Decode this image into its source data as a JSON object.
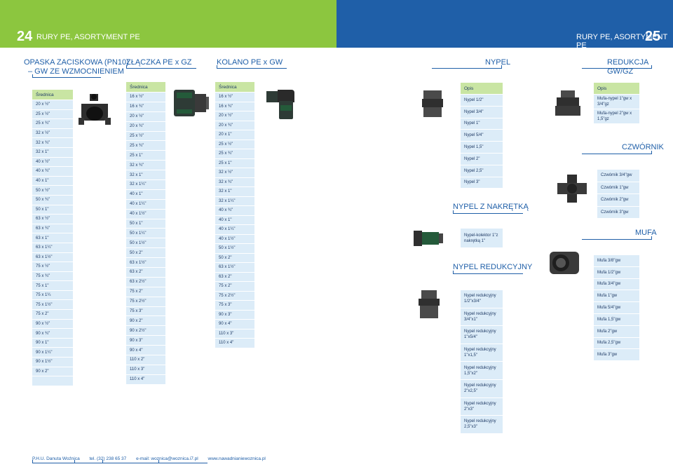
{
  "header": {
    "left_page_num": "24",
    "left_title": "RURY PE, ASORTYMENT PE",
    "right_title": "RURY PE, ASORTYMENT PE",
    "right_page_num": "25",
    "left_color": "#8cc63f",
    "right_color": "#1f5fa8"
  },
  "sections": {
    "opaska": {
      "title_line1": "OPASKA ZACISKOWA (PN10)",
      "title_line2": "– GW ZE WZMOCNIENIEM"
    },
    "zlaczka": {
      "title": "ZŁĄCZKA PE x GZ"
    },
    "kolano": {
      "title": "KOLANO PE x GW"
    },
    "nypel": {
      "title": "NYPEL"
    },
    "redukcja": {
      "title": "REDUKCJA GW/GZ"
    },
    "czwornik": {
      "title": "CZWÓRNIK"
    },
    "nypel_nakretka": {
      "title": "NYPEL Z NAKRĘTKĄ"
    },
    "mufa": {
      "title": "MUFA"
    },
    "nypel_redukcyjny": {
      "title": "NYPEL REDUKCYJNY"
    }
  },
  "opaska_table": {
    "header": "Średnica",
    "rows": [
      "20 x ½\"",
      "25 x ½\"",
      "25 x ¾\"",
      "32 x ½\"",
      "32 x ¾\"",
      "32 x 1\"",
      "40 x ½\"",
      "40 x ¾\"",
      "40 x 1\"",
      "50 x ½\"",
      "50 x ¾\"",
      "50 x 1\"",
      "63 x ½\"",
      "63 x ¾\"",
      "63 x 1\"",
      "63 x 1¼\"",
      "63 x 1½\"",
      "75 x ½\"",
      "75 x ¾\"",
      "75 x 1\"",
      "75 x 1¼",
      "75 x 1½\"",
      "75 x 2\"",
      "90 x ½\"",
      "90 x ¾\"",
      "90 x 1\"",
      "90 x 1¼\"",
      "90 x 1½\"",
      "90 x 2\"",
      ""
    ]
  },
  "zlaczka_table": {
    "header": "Średnica",
    "rows": [
      "16 x ½\"",
      "16 x ¾\"",
      "20 x ½\"",
      "20 x ¾\"",
      "25 x ½\"",
      "25 x ¾\"",
      "25 x 1\"",
      "32 x ¾\"",
      "32 x 1\"",
      "32 x 1¼\"",
      "40 x 1\"",
      "40 x 1¼\"",
      "40 x 1½\"",
      "50 x 1\"",
      "50 x 1¼\"",
      "50 x 1½\"",
      "50 x 2\"",
      "63 x 1½\"",
      "63 x 2\"",
      "63 x 2½\"",
      "75 x 2\"",
      "75 x 2½\"",
      "75 x 3\"",
      "90 x 2\"",
      "90 x 2½\"",
      "90 x 3\"",
      "90 x 4\"",
      "110 x 2\"",
      "110 x 3\"",
      "110 x 4\""
    ]
  },
  "kolano_table": {
    "header": "Średnica",
    "rows": [
      "16 x ½\"",
      "16 x ¾\"",
      "20 x ½\"",
      "20 x ¾\"",
      "20 x 1\"",
      "25 x ½\"",
      "25 x ¾\"",
      "25 x 1\"",
      "32 x ½\"",
      "32 x ¾\"",
      "32 x 1\"",
      "32 x 1¼\"",
      "40 x ¾\"",
      "40 x 1\"",
      "40 x 1¼\"",
      "40 x 1½\"",
      "50 x 1½\"",
      "50 x 2\"",
      "63 x 1½\"",
      "63 x 2\"",
      "75 x 2\"",
      "75 x 2½\"",
      "75 x 3\"",
      "90 x 3\"",
      "90 x 4\"",
      "110 x 3\"",
      "110 x 4\""
    ]
  },
  "nypel_table": {
    "header": "Opis",
    "rows": [
      "Nypel 1/2\"",
      "Nypel 3/4\"",
      "Nypel 1\"",
      "Nypel 5/4\"",
      "Nypel 1,5\"",
      "Nypel 2\"",
      "Nypel 2,5\"",
      "Nypel 3\""
    ]
  },
  "redukcja_table": {
    "header": "Opis",
    "rows": [
      "Mufa-nypel 1\"gw x 3/4\"gz",
      "Mufa-nypel 2\"gw x 1,5\"gz"
    ]
  },
  "czwornik_table": {
    "rows": [
      "Czwórnik 3/4\"gw",
      "Czwórnik 1\"gw",
      "Czwórnik 2\"gw",
      "Czwórnik 3\"gw"
    ]
  },
  "nakretka_table": {
    "rows": [
      "Nypel-kolektor 1\"z nakrętką 1\""
    ]
  },
  "mufa_table": {
    "rows": [
      "Mufa 3/8\"gw",
      "Mufa 1/2\"gw",
      "Mufa 3/4\"gw",
      "Mufa 1\"gw",
      "Mufa 5/4\"gw",
      "Mufa 1,5\"gw",
      "Mufa 2\"gw",
      "Mufa 2,5\"gw",
      "Mufa 3\"gw"
    ]
  },
  "redukcyjny_table": {
    "rows": [
      "Nypel redukcyjny 1/2\"x3/4\"",
      "Nypel redukcyjny 3/4\"x1\"",
      "Nypel redukcyjny 1\"x5/4\"",
      "Nypel redukcyjny 1\"x1,5\"",
      "Nypel redukcyjny 1,5\"x2\"",
      "Nypel redukcyjny 2\"x2,5\"",
      "Nypel redukcyjny 2\"x3\"",
      "Nypel redukcyjny 2,5\"x3\""
    ]
  },
  "footer": {
    "company": "P.H.U. Danuta Woźnica",
    "phone": "tel. (32) 238 65 37",
    "email": "e-mail: woznica@woznica.i7.pl",
    "web": "www.nawadnianiewoznica.pl"
  }
}
